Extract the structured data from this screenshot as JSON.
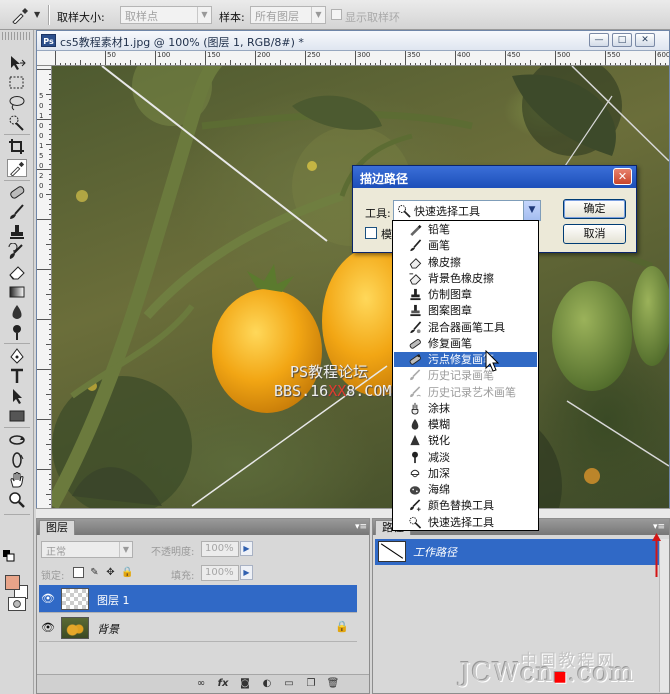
{
  "options_bar": {
    "sample_size_label": "取样大小:",
    "sample_size_value": "取样点",
    "sample_label": "样本:",
    "sample_value": "所有图层",
    "show_ring_label": "显示取样环"
  },
  "document": {
    "title": "cs5教程素材1.jpg @ 100% (图层 1, RGB/8#) *",
    "ruler_numbers": [
      "50",
      "100",
      "150",
      "200",
      "250",
      "300",
      "350",
      "400",
      "450",
      "500",
      "550",
      "600"
    ],
    "ruler_v_numbers": [
      "5",
      "0",
      "1",
      "0",
      "0",
      "1",
      "5",
      "0",
      "2",
      "0",
      "0"
    ],
    "watermark_line1": "PS教程论坛",
    "watermark_line2_a": "BBS.16",
    "watermark_line2_b": "XX",
    "watermark_line2_c": "8.COM"
  },
  "dialog": {
    "title": "描边路径",
    "tool_label": "工具:",
    "tool_value": "快速选择工具",
    "ok_label": "确定",
    "cancel_label": "取消",
    "simulate_label": "模拟压力"
  },
  "tool_dropdown": {
    "items": [
      {
        "label": "铅笔",
        "icon": "pencil-icon",
        "state": "normal"
      },
      {
        "label": "画笔",
        "icon": "brush-icon",
        "state": "normal"
      },
      {
        "label": "橡皮擦",
        "icon": "eraser-icon",
        "state": "normal"
      },
      {
        "label": "背景色橡皮擦",
        "icon": "background-eraser-icon",
        "state": "normal"
      },
      {
        "label": "仿制图章",
        "icon": "clone-stamp-icon",
        "state": "normal"
      },
      {
        "label": "图案图章",
        "icon": "pattern-stamp-icon",
        "state": "normal"
      },
      {
        "label": "混合器画笔工具",
        "icon": "mixer-brush-icon",
        "state": "normal"
      },
      {
        "label": "修复画笔",
        "icon": "healing-brush-icon",
        "state": "normal"
      },
      {
        "label": "污点修复画笔",
        "icon": "spot-healing-brush-icon",
        "state": "highlighted"
      },
      {
        "label": "历史记录画笔",
        "icon": "history-brush-icon",
        "state": "disabled"
      },
      {
        "label": "历史记录艺术画笔",
        "icon": "art-history-brush-icon",
        "state": "disabled"
      },
      {
        "label": "涂抹",
        "icon": "smudge-icon",
        "state": "normal"
      },
      {
        "label": "模糊",
        "icon": "blur-icon",
        "state": "normal"
      },
      {
        "label": "锐化",
        "icon": "sharpen-icon",
        "state": "normal"
      },
      {
        "label": "减淡",
        "icon": "dodge-icon",
        "state": "normal"
      },
      {
        "label": "加深",
        "icon": "burn-icon",
        "state": "normal"
      },
      {
        "label": "海绵",
        "icon": "sponge-icon",
        "state": "normal"
      },
      {
        "label": "颜色替换工具",
        "icon": "color-replacement-icon",
        "state": "normal"
      },
      {
        "label": "快速选择工具",
        "icon": "quick-selection-icon",
        "state": "normal"
      }
    ]
  },
  "layers_panel": {
    "tab_label": "图层",
    "blend_mode": "正常",
    "opacity_label": "不透明度:",
    "opacity_value": "100%",
    "lock_label": "锁定:",
    "fill_label": "填充:",
    "fill_value": "100%",
    "layers": [
      {
        "name": "图层 1",
        "selected": true
      },
      {
        "name": "背景",
        "selected": false,
        "locked": true
      }
    ]
  },
  "paths_panel": {
    "tab_label": "路径",
    "paths": [
      {
        "name": "工作路径",
        "selected": true
      }
    ]
  },
  "site_watermark": {
    "cn": "中国教程网",
    "en_a": "JCWcn",
    "en_b": ".com"
  },
  "colors": {
    "foreground": "#e8a489",
    "background": "#ffffff",
    "selection_blue": "#3069c6",
    "dialog_titlebar": "#2557c8"
  }
}
